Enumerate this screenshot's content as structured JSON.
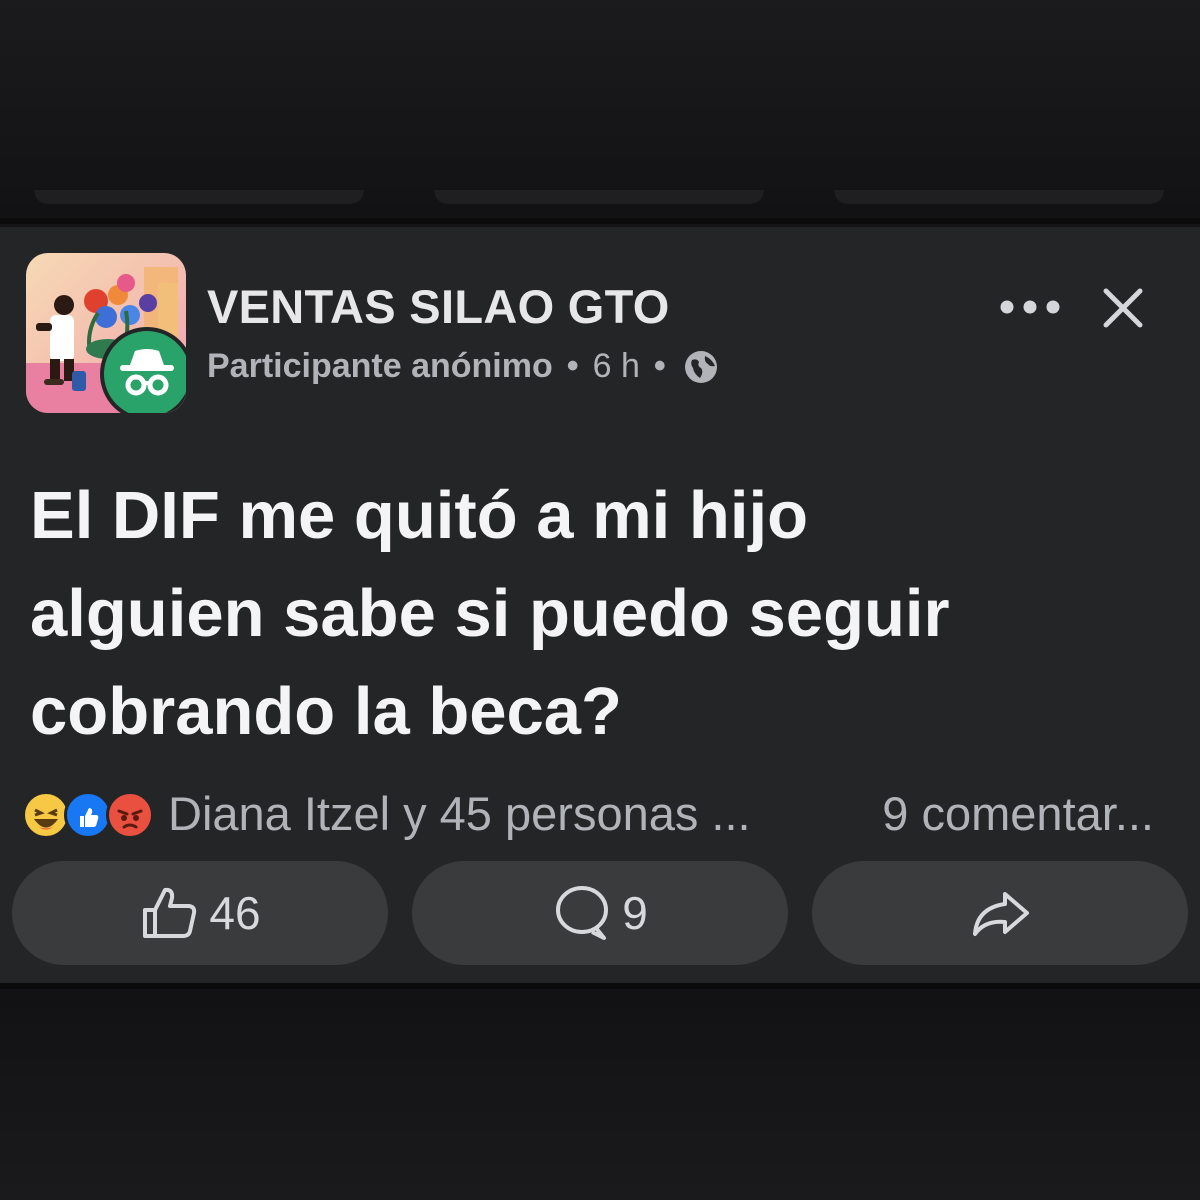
{
  "post": {
    "group_name": "VENTAS SILAO GTO",
    "author": "Participante anónimo",
    "separator": "•",
    "time": "6 h",
    "privacy_icon": "globe-icon",
    "more_icon": "more-horizontal-icon",
    "close_icon": "close-icon",
    "text_lines": [
      "El DIF me quitó a mi hijo",
      "alguien sabe si puedo seguir",
      "cobrando la beca?"
    ]
  },
  "summary": {
    "reaction_icons": [
      "haha-reaction-icon",
      "like-reaction-icon",
      "angry-reaction-icon"
    ],
    "reactors_text": "Diana Itzel y 45 personas ...",
    "comments_text": "9 comentar..."
  },
  "actions": {
    "like": {
      "icon": "thumbs-up-icon",
      "count": "46"
    },
    "comment": {
      "icon": "comment-bubble-icon",
      "count": "9"
    },
    "share": {
      "icon": "share-arrow-icon"
    }
  },
  "colors": {
    "card_background": "#242526",
    "button_background": "#3a3b3d",
    "anonymous_badge": "#2aa36a",
    "like_blue": "#1877f2",
    "angry_red": "#e9503f",
    "haha_yellow": "#f7c843"
  }
}
